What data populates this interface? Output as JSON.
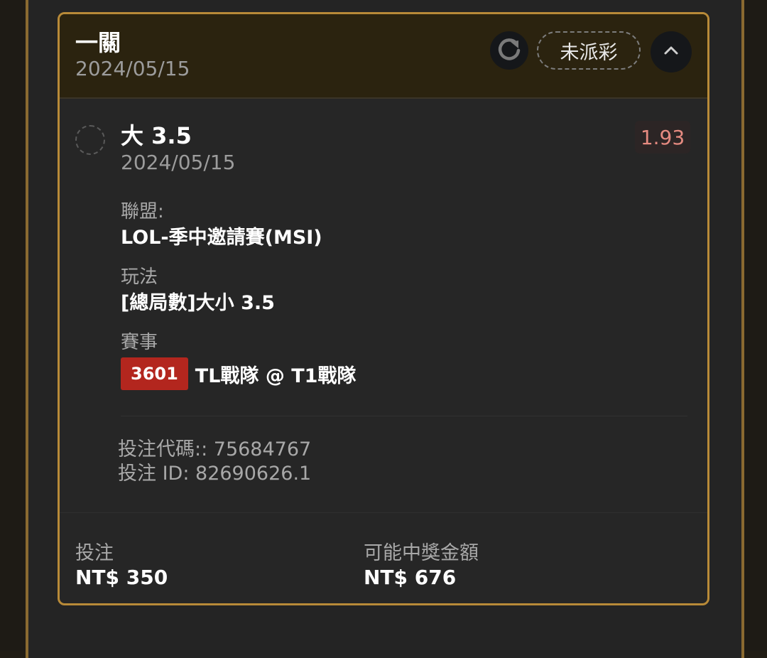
{
  "header": {
    "bet_type": "一關",
    "date": "2024/05/15",
    "status_label": "未派彩"
  },
  "selection": {
    "pick": "大 3.5",
    "date": "2024/05/15",
    "odds": "1.93",
    "league_label": "聯盟:",
    "league_value": "LOL-季中邀請賽(MSI)",
    "market_label": "玩法",
    "market_value": "[總局數]大小 3.5",
    "event_label": "賽事",
    "event_code": "3601",
    "event_name": "TL戰隊 @ T1戰隊"
  },
  "codes": {
    "bet_code": "投注代碼:: 75684767",
    "bet_id": "投注 ID: 82690626.1"
  },
  "summary": {
    "stake_label": "投注",
    "stake_value": "NT$ 350",
    "payout_label": "可能中獎金額",
    "payout_value": "NT$ 676"
  },
  "icons": {
    "refresh": "refresh-icon",
    "collapse": "chevron-up-icon"
  },
  "colors": {
    "card_border": "#b88a38",
    "header_bg": "#2b230f",
    "odds_text": "#e58a80",
    "event_code_bg": "#b3261e"
  }
}
